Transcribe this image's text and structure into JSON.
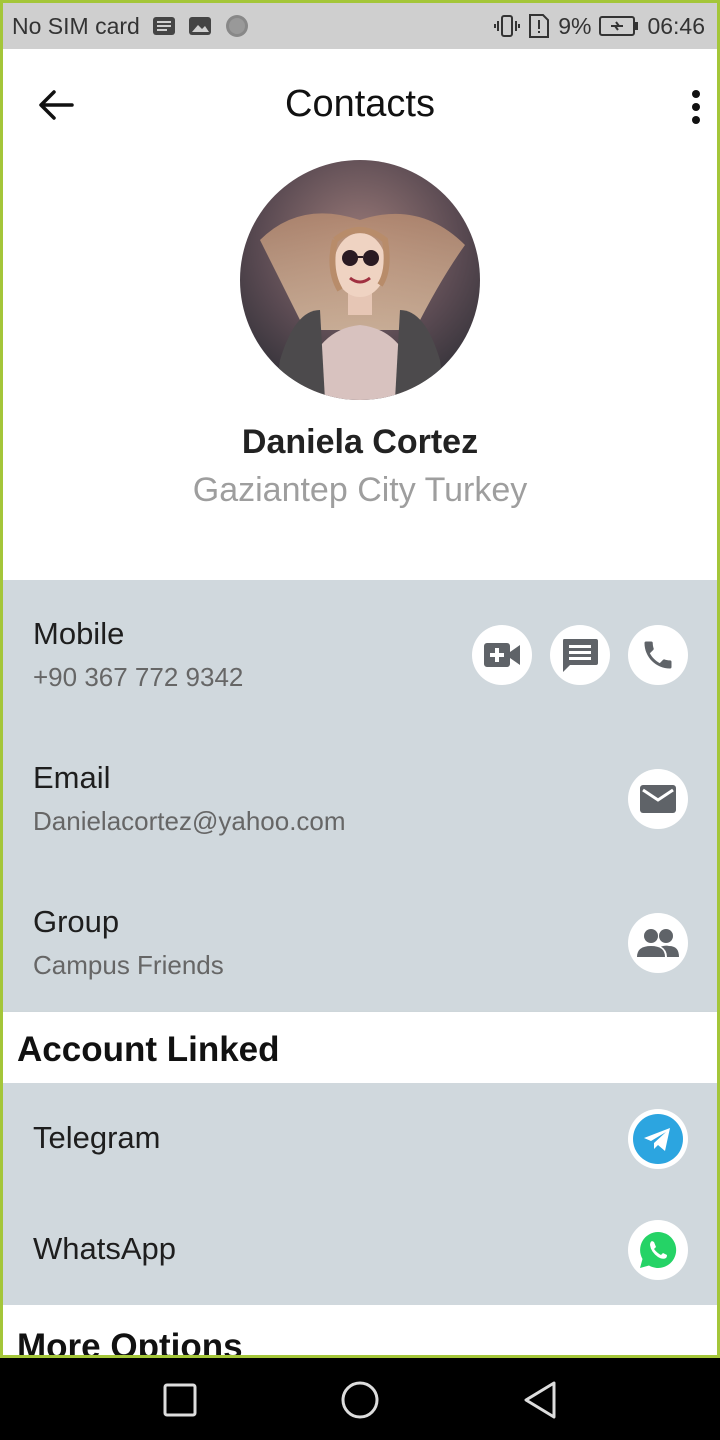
{
  "status_bar": {
    "carrier": "No SIM card",
    "battery": "9%",
    "time": "06:46"
  },
  "app_bar": {
    "title": "Contacts"
  },
  "profile": {
    "name": "Daniela Cortez",
    "location": "Gaziantep City Turkey"
  },
  "contact_info": [
    {
      "label": "Mobile",
      "value": "+90 367 772 9342"
    },
    {
      "label": "Email",
      "value": "Danielacortez@yahoo.com"
    },
    {
      "label": "Group",
      "value": "Campus Friends"
    }
  ],
  "account_linked": {
    "heading": "Account Linked",
    "items": [
      {
        "label": "Telegram"
      },
      {
        "label": "WhatsApp"
      }
    ]
  },
  "more_options": {
    "heading": "More Options"
  },
  "colors": {
    "section_bg": "#d0d8dd",
    "telegram": "#2ca5e0",
    "whatsapp": "#25d366",
    "icon_gray": "#5f6368"
  }
}
